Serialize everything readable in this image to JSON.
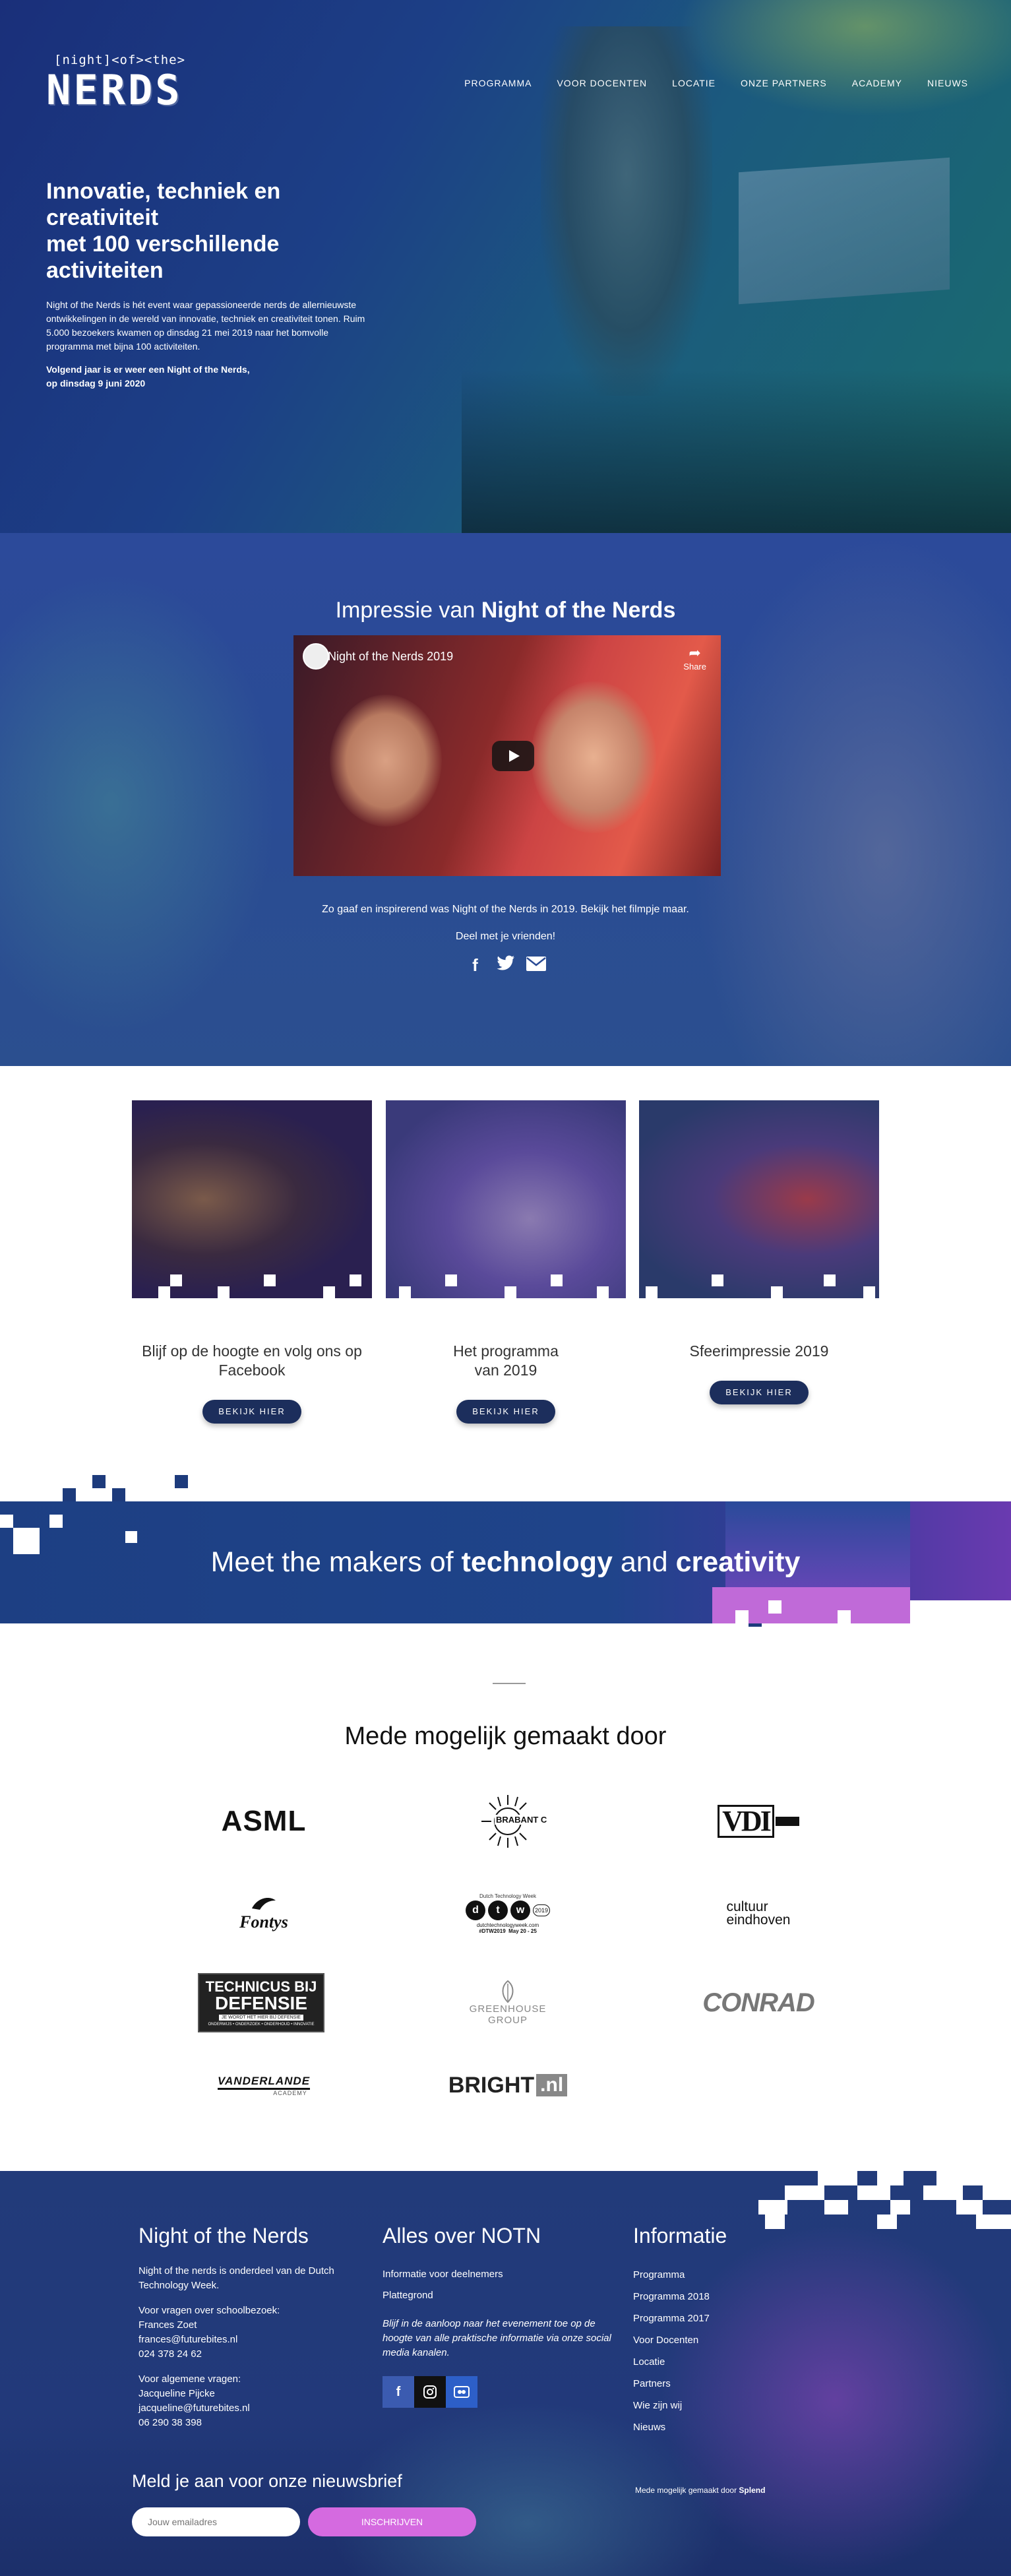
{
  "header": {
    "logo_small": "[night]<of><the>",
    "logo_big": "NERDS",
    "nav": [
      "PROGRAMMA",
      "VOOR DOCENTEN",
      "LOCATIE",
      "ONZE PARTNERS",
      "ACADEMY",
      "NIEUWS"
    ]
  },
  "hero": {
    "title_lines": [
      "Innovatie, techniek en",
      "creativiteit",
      "met 100 verschillende",
      "activiteiten"
    ],
    "intro": "Night of the Nerds is hét event waar gepassioneerde nerds de allernieuwste ontwikkelingen in de wereld van innovatie, techniek en creativiteit tonen. Ruim 5.000 bezoekers kwamen op dinsdag 21 mei 2019 naar het bomvolle programma met bijna 100 activiteiten.",
    "next_line1": "Volgend jaar is er weer een Night of the Nerds,",
    "next_line2": "op dinsdag 9 juni 2020"
  },
  "impressie": {
    "title_plain": "Impressie van ",
    "title_bold": "Night of the Nerds",
    "video_title": "Night of the Nerds 2019",
    "video_share": "Share",
    "description": "Zo gaaf en inspirerend was Night of the Nerds in 2019. Bekijk het filmpje maar.",
    "share_prompt": "Deel met je vrienden!",
    "social_icons": [
      "facebook-icon",
      "twitter-icon",
      "envelope-icon"
    ]
  },
  "cards": [
    {
      "caption_line1": "Blijf op de hoogte en volg ons op",
      "caption_line2": "Facebook",
      "button": "BEKIJK HIER"
    },
    {
      "caption_line1": "Het programma",
      "caption_line2": "van 2019",
      "button": "BEKIJK HIER"
    },
    {
      "caption_line1": "Sfeerimpressie 2019",
      "caption_line2": "",
      "button": "BEKIJK HIER"
    }
  ],
  "banner": {
    "plain1": "Meet the makers of ",
    "bold1": "technology",
    "plain2": " and ",
    "bold2": "creativity"
  },
  "sponsors": {
    "title": "Mede mogelijk gemaakt door",
    "logos": [
      "ASML",
      "BRABANT C",
      "VDI",
      "Fontys",
      "dtw",
      "cultuur eindhoven",
      "TECHNICUS BIJ DEFENSIE",
      "GREENHOUSE GROUP",
      "CONRAD",
      "VANDERLANDE",
      "BRIGHT.nl"
    ],
    "brabant_sub": "BRABANT C",
    "dtw_sub": "dutchtechnologyweek.com",
    "dtw_tag": "#DTW2019",
    "dtw_dates": "May 20 - 25",
    "dtw_year": "2019",
    "dtw_top": "Dutch Technology Week",
    "defensie_line1": "TECHNICUS BIJ",
    "defensie_line2": "DEFENSIE",
    "defensie_line3": "JE WORDT HET HIER BIJ DEFENSIE",
    "defensie_line4": "ONDERWIJS • ONDERZOEK • ONDERHOUD • INNOVATIE",
    "greenhouse_line1": "GREENHOUSE",
    "greenhouse_line2": "GROUP",
    "cultuur_line1": "cultuur",
    "cultuur_line2": "eindhoven",
    "vanderlande_line1": "VANDERLANDE",
    "vanderlande_line2": "ACADEMY",
    "bright_a": "BRIGHT",
    "bright_b": ".nl"
  },
  "footer": {
    "col1": {
      "title": "Night of the Nerds",
      "about": "Night of the nerds is onderdeel van de Dutch Technology Week.",
      "school_label": "Voor vragen over schoolbezoek:",
      "school_name": "Frances Zoet",
      "school_email": "frances@futurebites.nl",
      "school_phone": "024 378 24 62",
      "general_label": "Voor algemene vragen:",
      "general_name": "Jacqueline Pijcke",
      "general_email": "jacqueline@futurebites.nl",
      "general_phone": "06 290 38 398"
    },
    "col2": {
      "title": "Alles over NOTN",
      "link1": "Informatie voor deelnemers",
      "link2": "Plattegrond",
      "note": "Blijf in de aanloop naar het evenement toe op de hoogte van alle praktische informatie via onze social media kanalen.",
      "icons": [
        "facebook-icon",
        "instagram-icon",
        "flickr-icon"
      ]
    },
    "col3": {
      "title": "Informatie",
      "links": [
        "Programma",
        "Programma 2018",
        "Programma 2017",
        "Voor Docenten",
        "Locatie",
        "Partners",
        "Wie zijn wij",
        "Nieuws"
      ]
    },
    "newsletter": {
      "title": "Meld je aan voor onze nieuwsbrief",
      "placeholder": "Jouw emailadres",
      "button": "INSCHRIJVEN"
    },
    "made_by_text": "Mede mogelijk gemaakt door ",
    "made_by_brand": "Splend"
  },
  "colors": {
    "button_navy": "#1c2e5c",
    "accent_pink": "#d56ae0",
    "hero_blue": "#1c3f86"
  }
}
